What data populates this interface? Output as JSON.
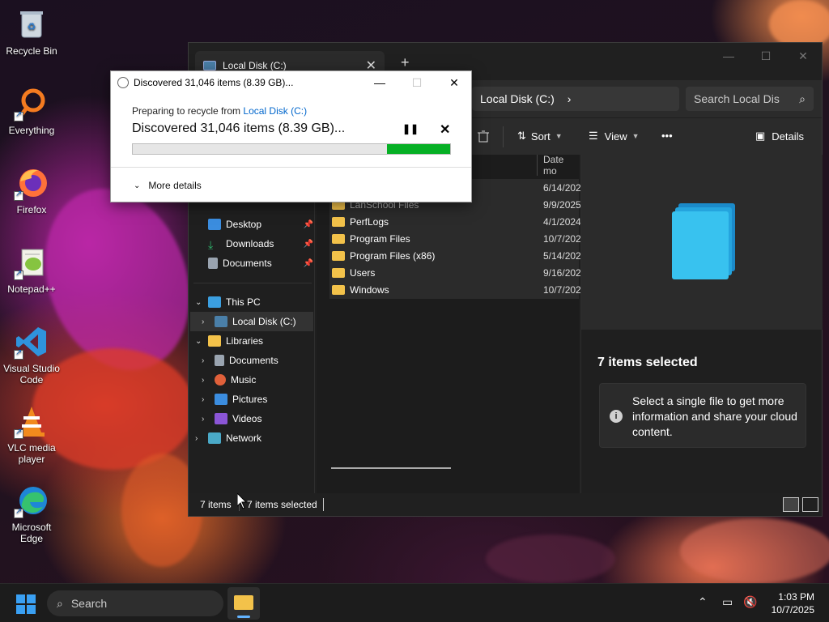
{
  "desktop": {
    "icons": [
      {
        "label": "Recycle Bin",
        "icon": "recycle-bin-icon"
      },
      {
        "label": "Everything",
        "icon": "magnifier-icon"
      },
      {
        "label": "Firefox",
        "icon": "firefox-icon"
      },
      {
        "label": "Notepad++",
        "icon": "notepad-icon"
      },
      {
        "label": "Visual Studio Code",
        "icon": "vscode-icon"
      },
      {
        "label": "VLC media player",
        "icon": "vlc-icon"
      },
      {
        "label": "Microsoft Edge",
        "icon": "edge-icon"
      }
    ]
  },
  "explorer": {
    "tab_label": "Local Disk (C:)",
    "new_tab": "+",
    "breadcrumb": "Local Disk (C:)",
    "search_placeholder": "Search Local Dis",
    "commands": {
      "sort": "Sort",
      "view": "View",
      "more": "•••",
      "details": "Details"
    },
    "column_date": "Date mo",
    "nav": {
      "quick": [
        {
          "label": "Desktop",
          "color": "#3b8ddf"
        },
        {
          "label": "Downloads",
          "color": "#2fb36b"
        },
        {
          "label": "Documents",
          "color": "#9aa4b0"
        }
      ],
      "this_pc": "This PC",
      "local_disk": "Local Disk (C:)",
      "libraries": "Libraries",
      "lib_items": [
        {
          "label": "Documents",
          "color": "#9aa4b0"
        },
        {
          "label": "Music",
          "color": "#e0603a"
        },
        {
          "label": "Pictures",
          "color": "#3b8ddf"
        },
        {
          "label": "Videos",
          "color": "#8b55d6"
        }
      ],
      "network": "Network"
    },
    "files": [
      {
        "name": "",
        "date": "6/14/202"
      },
      {
        "name": "LanSchool Files",
        "date": "9/9/2025"
      },
      {
        "name": "PerfLogs",
        "date": "4/1/2024"
      },
      {
        "name": "Program Files",
        "date": "10/7/202"
      },
      {
        "name": "Program Files (x86)",
        "date": "5/14/202"
      },
      {
        "name": "Users",
        "date": "9/16/202"
      },
      {
        "name": "Windows",
        "date": "10/7/202"
      }
    ],
    "details": {
      "selected_title": "7 items selected",
      "info_text": "Select a single file to get more information and share your cloud content."
    },
    "status": {
      "count": "7 items",
      "selected": "7 items selected"
    }
  },
  "dialog": {
    "title": "Discovered 31,046 items (8.39 GB)...",
    "line1_prefix": "Preparing to recycle from ",
    "line1_link": "Local Disk (C:)",
    "line2": "Discovered 31,046 items (8.39 GB)...",
    "progress_fraction": 0.2,
    "more_details": "More details"
  },
  "taskbar": {
    "search_label": "Search",
    "time": "1:03 PM",
    "date": "10/7/2025"
  },
  "colors": {
    "accent": "#3aa0f3",
    "progress": "#06b025",
    "folder": "#f3c24a"
  }
}
